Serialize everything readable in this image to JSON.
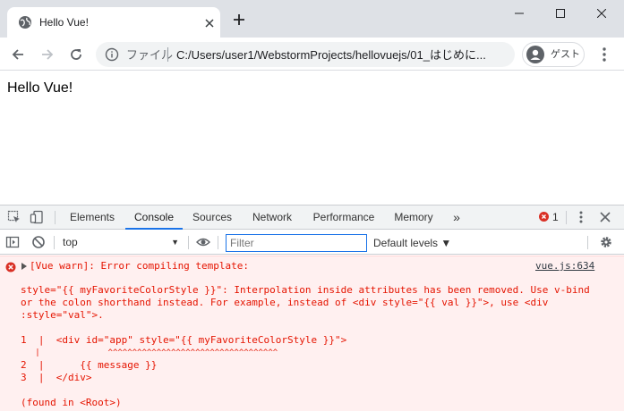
{
  "browser": {
    "tab_title": "Hello Vue!",
    "url_scheme_label": "ファイル",
    "url": "C:/Users/user1/WebstormProjects/hellovuejs/01_はじめに...",
    "profile_label": "ゲスト"
  },
  "page": {
    "body_text": "Hello Vue!"
  },
  "devtools": {
    "tabs": [
      "Elements",
      "Console",
      "Sources",
      "Network",
      "Performance",
      "Memory"
    ],
    "active_tab": "Console",
    "more_tabs": "»",
    "error_count": "1",
    "context": "top",
    "filter_placeholder": "Filter",
    "levels_label": "Default levels ▼"
  },
  "console": {
    "message_title": "[Vue warn]: Error compiling template:",
    "message_source": "vue.js:634",
    "lines": [
      "style=\"{{ myFavoriteColorStyle }}\": Interpolation inside attributes has been removed. Use v-bind",
      "or the colon shorthand instead. For example, instead of <div style=\"{{ val }}\">, use <div",
      ":style=\"val\">.",
      "",
      "1  |  <div id=\"app\" style=\"{{ myFavoriteColorStyle }}\">",
      "   |              ^^^^^^^^^^^^^^^^^^^^^^^^^^^^^^^^^^^",
      "2  |      {{ message }}",
      "3  |  </div>",
      "",
      "(found in <Root>)"
    ]
  },
  "colors": {
    "tabstrip_bg": "#dee1e6",
    "console_error_bg": "#fff0f0",
    "console_error_text": "#e51400",
    "accent_blue": "#1a73e8"
  },
  "icons": {
    "favicon": "globe-icon",
    "new_tab": "plus-icon",
    "back": "back-arrow-icon",
    "forward": "forward-arrow-icon",
    "reload": "reload-icon",
    "site_info": "info-icon",
    "profile": "person-icon",
    "menu": "kebab-icon"
  }
}
